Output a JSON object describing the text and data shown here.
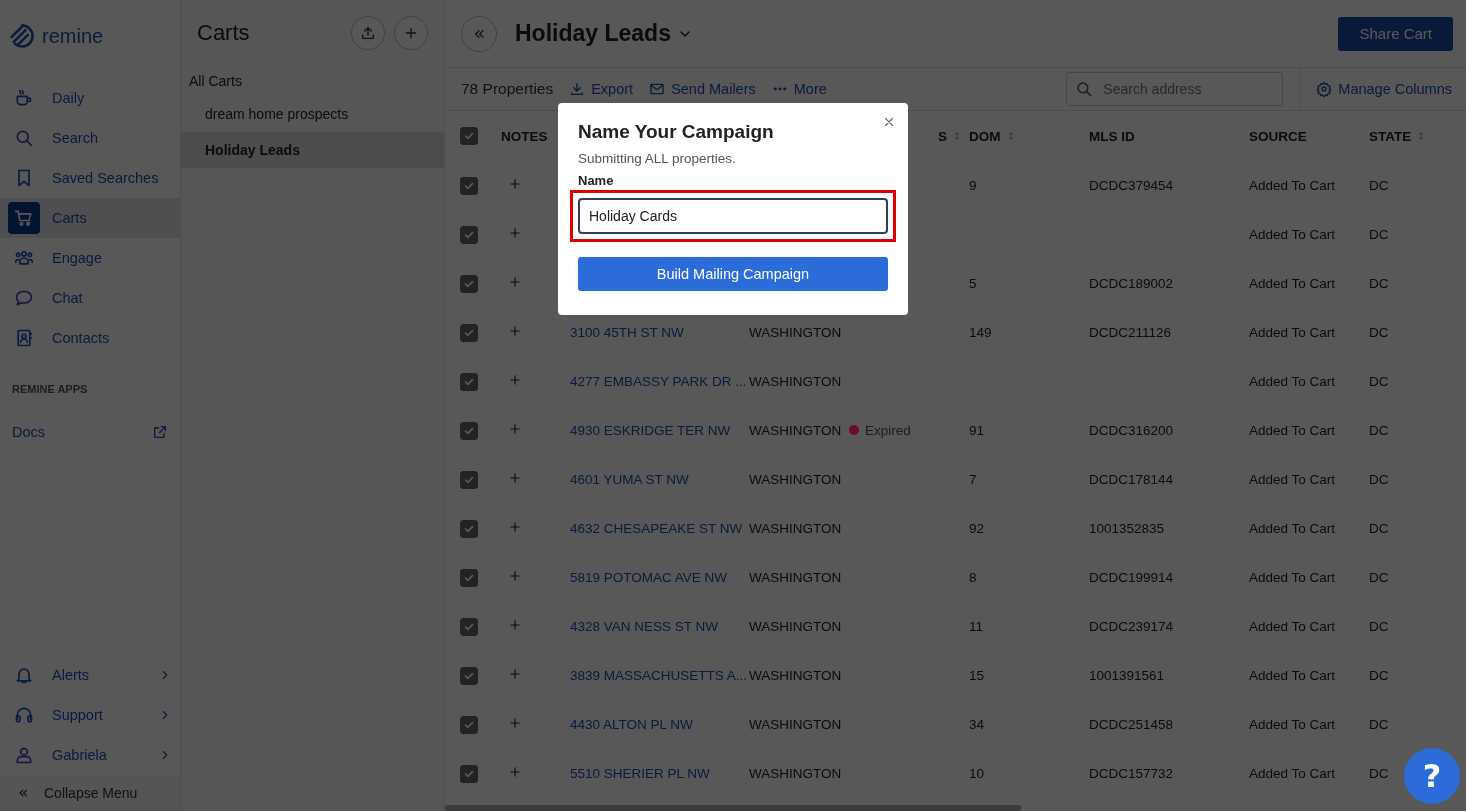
{
  "sidebar": {
    "logo_text": "remine",
    "items": [
      {
        "label": "Daily",
        "selected": false
      },
      {
        "label": "Search",
        "selected": false
      },
      {
        "label": "Saved Searches",
        "selected": false
      },
      {
        "label": "Carts",
        "selected": true
      },
      {
        "label": "Engage",
        "selected": false
      },
      {
        "label": "Chat",
        "selected": false
      },
      {
        "label": "Contacts",
        "selected": false
      }
    ],
    "section_label": "REMINE APPS",
    "apps": [
      {
        "label": "Docs"
      }
    ],
    "footer_items": [
      {
        "label": "Alerts"
      },
      {
        "label": "Support"
      },
      {
        "label": "Gabriela"
      }
    ],
    "collapse_label": "Collapse Menu"
  },
  "carts_panel": {
    "title": "Carts",
    "all_label": "All Carts",
    "items": [
      {
        "label": "dream home prospects",
        "selected": false
      },
      {
        "label": "Holiday Leads",
        "selected": true
      }
    ]
  },
  "header": {
    "title": "Holiday Leads",
    "share_button": "Share Cart"
  },
  "toolbar": {
    "count": "78 Properties",
    "actions": [
      "Export",
      "Send Mailers",
      "More"
    ],
    "search": {
      "placeholder": "Search address"
    },
    "manage_columns": "Manage Columns"
  },
  "table": {
    "all_checked": true,
    "columns": [
      {
        "label": "NOTES",
        "sortable": false
      },
      {
        "label": "S",
        "sortable": true
      },
      {
        "label": "DOM",
        "sortable": true
      },
      {
        "label": "MLS ID",
        "sortable": false
      },
      {
        "label": "SOURCE",
        "sortable": false
      },
      {
        "label": "STATE",
        "sortable": true
      }
    ],
    "rows": [
      {
        "checked": true,
        "dom": "9",
        "mls_id": "DCDC379454",
        "source": "Added To Cart",
        "state": "DC"
      },
      {
        "checked": true,
        "source": "Added To Cart",
        "state": "DC"
      },
      {
        "checked": true,
        "dom": "5",
        "mls_id": "DCDC189002",
        "source": "Added To Cart",
        "state": "DC"
      },
      {
        "checked": true,
        "address": "3100 45TH ST NW",
        "city": "WASHINGTON",
        "dom": "149",
        "mls_id": "DCDC211126",
        "source": "Added To Cart",
        "state": "DC"
      },
      {
        "checked": true,
        "address": "4277 EMBASSY PARK DR ...",
        "city": "WASHINGTON",
        "source": "Added To Cart",
        "state": "DC"
      },
      {
        "checked": true,
        "address": "4930 ESKRIDGE TER NW",
        "city": "WASHINGTON",
        "status": {
          "label": "Expired",
          "color": "#6e0b28"
        },
        "dom": "91",
        "mls_id": "DCDC316200",
        "source": "Added To Cart",
        "state": "DC"
      },
      {
        "checked": true,
        "address": "4601 YUMA ST NW",
        "city": "WASHINGTON",
        "dom": "7",
        "mls_id": "DCDC178144",
        "source": "Added To Cart",
        "state": "DC"
      },
      {
        "checked": true,
        "address": "4632 CHESAPEAKE ST NW",
        "city": "WASHINGTON",
        "dom": "92",
        "mls_id": "1001352835",
        "source": "Added To Cart",
        "state": "DC"
      },
      {
        "checked": true,
        "address": "5819 POTOMAC AVE NW",
        "city": "WASHINGTON",
        "dom": "8",
        "mls_id": "DCDC199914",
        "source": "Added To Cart",
        "state": "DC"
      },
      {
        "checked": true,
        "address": "4328 VAN NESS ST NW",
        "city": "WASHINGTON",
        "dom": "11",
        "mls_id": "DCDC239174",
        "source": "Added To Cart",
        "state": "DC"
      },
      {
        "checked": true,
        "address": "3839 MASSACHUSETTS A...",
        "city": "WASHINGTON",
        "dom": "15",
        "mls_id": "1001391561",
        "source": "Added To Cart",
        "state": "DC"
      },
      {
        "checked": true,
        "address": "4430 ALTON PL NW",
        "city": "WASHINGTON",
        "dom": "34",
        "mls_id": "DCDC251458",
        "source": "Added To Cart",
        "state": "DC"
      },
      {
        "checked": true,
        "address": "5510 SHERIER PL NW",
        "city": "WASHINGTON",
        "dom": "10",
        "mls_id": "DCDC157732",
        "source": "Added To Cart",
        "state": "DC"
      }
    ]
  },
  "modal": {
    "title": "Name Your Campaign",
    "subtitle": "Submitting ALL properties.",
    "field_label": "Name",
    "field_value": "Holiday Cards",
    "highlighted": true,
    "submit_button": "Build Mailing Campaign"
  },
  "help_button": "?"
}
